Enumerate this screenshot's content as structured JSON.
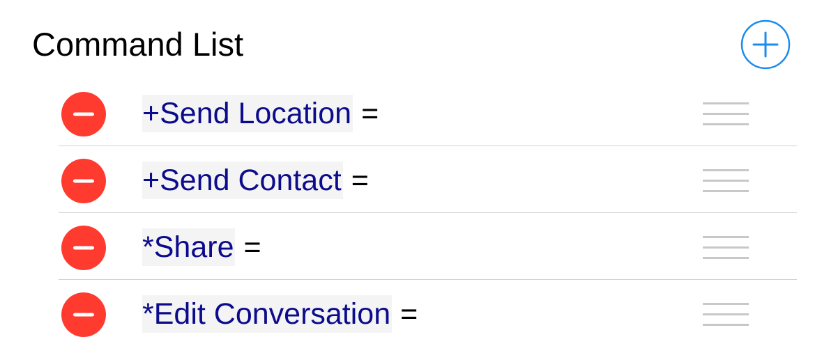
{
  "header": {
    "title": "Command List",
    "add_icon": "plus-circle-icon",
    "accent_color": "#1a8cf0"
  },
  "commands": [
    {
      "name": "+Send Location",
      "suffix": "="
    },
    {
      "name": "+Send Contact",
      "suffix": "="
    },
    {
      "name": "*Share",
      "suffix": "="
    },
    {
      "name": "*Edit Conversation",
      "suffix": "="
    }
  ],
  "colors": {
    "delete": "#ff3b30",
    "command_text": "#0c0b8c",
    "handle": "#c8c8c8"
  }
}
